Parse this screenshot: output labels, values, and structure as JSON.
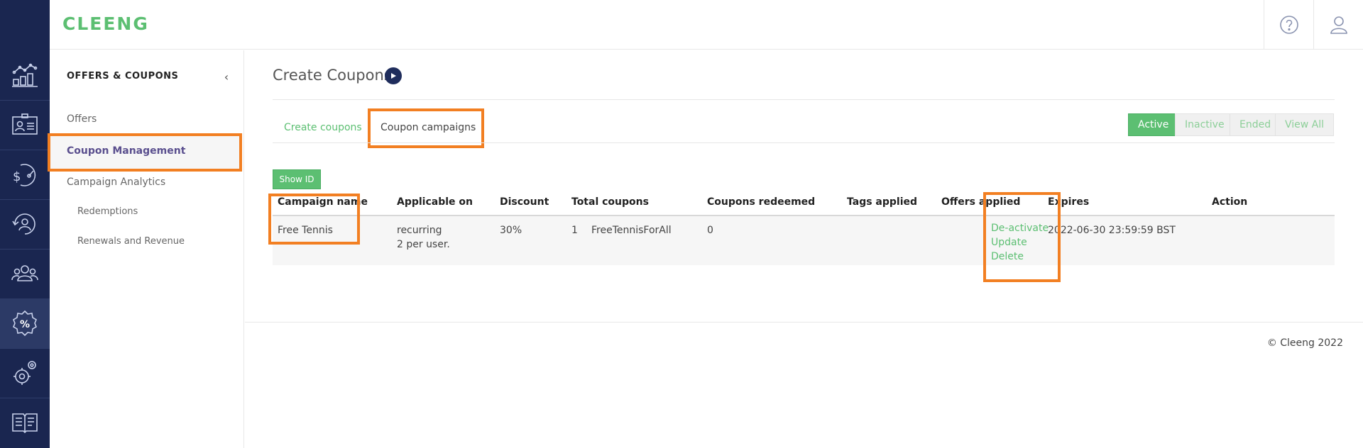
{
  "app": {
    "logo_text": "CLEENG",
    "brand_color": "#5cbf72",
    "nav_color": "#1a2650",
    "highlight_color": "#f27f22"
  },
  "rail": {
    "items": [
      {
        "icon": "analytics-icon"
      },
      {
        "icon": "customer-card-icon"
      },
      {
        "icon": "revenue-gauge-icon"
      },
      {
        "icon": "retention-icon"
      },
      {
        "icon": "users-icon"
      },
      {
        "icon": "coupon-percent-icon",
        "active": true
      },
      {
        "icon": "settings-gear-icon"
      },
      {
        "icon": "documentation-book-icon"
      }
    ]
  },
  "header": {
    "help_icon": "help-icon",
    "account_icon": "user-icon"
  },
  "sidebar": {
    "title": "OFFERS & COUPONS",
    "links": {
      "offers": "Offers",
      "coupon_management": "Coupon Management",
      "campaign_analytics": "Campaign Analytics"
    },
    "sub_links": {
      "redemptions": "Redemptions",
      "renewals": "Renewals and Revenue"
    }
  },
  "main": {
    "title": "Create Coupons",
    "tabs": {
      "create": "Create coupons",
      "campaigns": "Coupon campaigns"
    },
    "filters": {
      "active": "Active",
      "inactive": "Inactive",
      "ended": "Ended",
      "view_all": "View All"
    },
    "show_id": "Show ID",
    "table": {
      "headers": {
        "campaign_name": "Campaign name",
        "applicable_on": "Applicable on",
        "discount": "Discount",
        "total_coupons": "Total coupons",
        "coupons_redeemed": "Coupons redeemed",
        "tags_applied": "Tags applied",
        "offers_applied": "Offers applied",
        "expires": "Expires",
        "action": "Action"
      },
      "row": {
        "campaign_name": "Free Tennis",
        "applicable_on_1": "recurring",
        "applicable_on_2": "2 per user.",
        "discount": "30%",
        "total_coupons": "1",
        "coupon_code": "FreeTennisForAll",
        "coupons_redeemed": "0",
        "tags_applied": "",
        "offers_applied": "",
        "expires": "2022-06-30 23:59:59 BST",
        "actions": {
          "deactivate": "De-activate",
          "update": "Update",
          "delete": "Delete"
        }
      }
    }
  },
  "footer": {
    "copyright": "© Cleeng 2022"
  }
}
